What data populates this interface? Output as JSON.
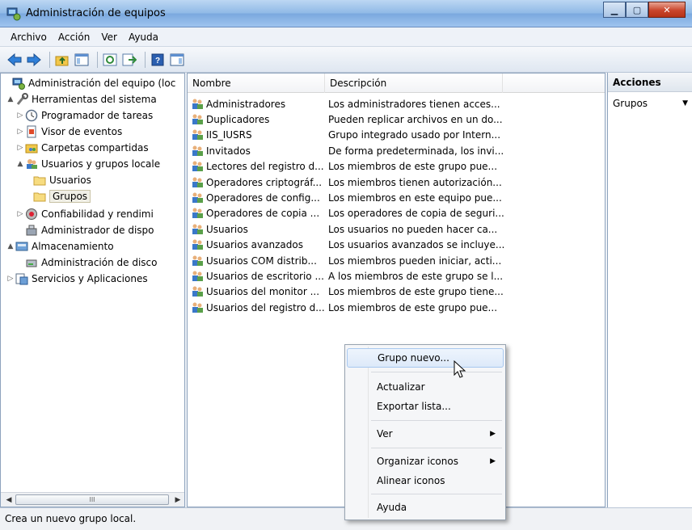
{
  "window": {
    "title": "Administración de equipos"
  },
  "menubar": {
    "items": [
      "Archivo",
      "Acción",
      "Ver",
      "Ayuda"
    ]
  },
  "tree": {
    "items": [
      {
        "label": "Administración del equipo (loc",
        "icon": "computer-management-icon",
        "arrow": "",
        "depth": 0
      },
      {
        "label": "Herramientas del sistema",
        "icon": "tools-icon",
        "arrow": "▲",
        "depth": 1
      },
      {
        "label": "Programador de tareas",
        "icon": "clock-icon",
        "arrow": "▷",
        "depth": 2
      },
      {
        "label": "Visor de eventos",
        "icon": "event-viewer-icon",
        "arrow": "▷",
        "depth": 2
      },
      {
        "label": "Carpetas compartidas",
        "icon": "shared-folder-icon",
        "arrow": "▷",
        "depth": 2
      },
      {
        "label": "Usuarios y grupos locale",
        "icon": "users-icon",
        "arrow": "▲",
        "depth": 2
      },
      {
        "label": "Usuarios",
        "icon": "folder-icon",
        "arrow": "",
        "depth": 3
      },
      {
        "label": "Grupos",
        "icon": "folder-icon",
        "arrow": "",
        "depth": 3
      },
      {
        "label": "Confiabilidad y rendimi",
        "icon": "reliability-icon",
        "arrow": "▷",
        "depth": 2
      },
      {
        "label": "Administrador de dispo",
        "icon": "device-manager-icon",
        "arrow": "",
        "depth": 2
      },
      {
        "label": "Almacenamiento",
        "icon": "storage-icon",
        "arrow": "▲",
        "depth": 1
      },
      {
        "label": "Administración de disco",
        "icon": "disk-icon",
        "arrow": "",
        "depth": 2
      },
      {
        "label": "Servicios y Aplicaciones",
        "icon": "services-icon",
        "arrow": "▷",
        "depth": 1
      }
    ],
    "scroll_grip": "III"
  },
  "list": {
    "columns": [
      "Nombre",
      "Descripción"
    ],
    "rows": [
      {
        "name": "Administradores",
        "desc": "Los administradores tienen acces..."
      },
      {
        "name": "Duplicadores",
        "desc": "Pueden replicar archivos en un do..."
      },
      {
        "name": "IIS_IUSRS",
        "desc": "Grupo integrado usado por Intern..."
      },
      {
        "name": "Invitados",
        "desc": "De forma predeterminada, los invi..."
      },
      {
        "name": "Lectores del registro d...",
        "desc": "Los miembros de este grupo pue..."
      },
      {
        "name": "Operadores criptográf...",
        "desc": "Los miembros tienen autorización..."
      },
      {
        "name": "Operadores de config...",
        "desc": "Los miembros en este equipo pue..."
      },
      {
        "name": "Operadores de copia ...",
        "desc": "Los operadores de copia de seguri..."
      },
      {
        "name": "Usuarios",
        "desc": "Los usuarios no pueden hacer ca..."
      },
      {
        "name": "Usuarios avanzados",
        "desc": "Los usuarios avanzados se incluye..."
      },
      {
        "name": "Usuarios COM distrib...",
        "desc": "Los miembros pueden iniciar, acti..."
      },
      {
        "name": "Usuarios de escritorio ...",
        "desc": "A los miembros de este grupo se l..."
      },
      {
        "name": "Usuarios del monitor ...",
        "desc": "Los miembros de este grupo tiene..."
      },
      {
        "name": "Usuarios del registro d...",
        "desc": "Los miembros de este grupo pue..."
      }
    ]
  },
  "actions": {
    "header": "Acciones",
    "item": "Grupos",
    "arrow": "▼"
  },
  "context_menu": {
    "items": [
      "Grupo nuevo...",
      "Actualizar",
      "Exportar lista...",
      "Ver",
      "Organizar iconos",
      "Alinear iconos",
      "Ayuda"
    ],
    "submenu_arrow": "▶"
  },
  "status": {
    "text": "Crea un nuevo grupo local."
  },
  "colors": {
    "accent": "#7aa8de",
    "selection": "#dde9f9"
  }
}
